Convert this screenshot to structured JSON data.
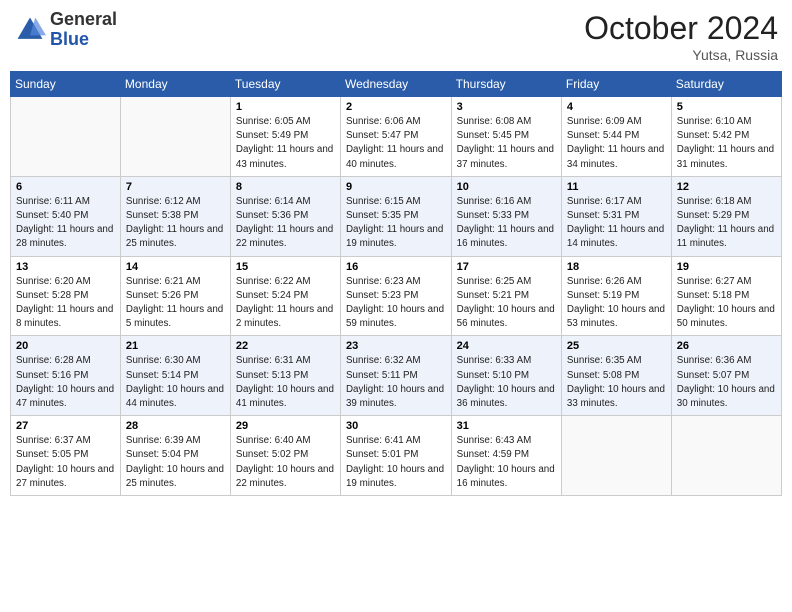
{
  "logo": {
    "general": "General",
    "blue": "Blue"
  },
  "title": "October 2024",
  "location": "Yutsa, Russia",
  "days_header": [
    "Sunday",
    "Monday",
    "Tuesday",
    "Wednesday",
    "Thursday",
    "Friday",
    "Saturday"
  ],
  "weeks": [
    [
      {
        "num": "",
        "detail": ""
      },
      {
        "num": "",
        "detail": ""
      },
      {
        "num": "1",
        "detail": "Sunrise: 6:05 AM\nSunset: 5:49 PM\nDaylight: 11 hours\nand 43 minutes."
      },
      {
        "num": "2",
        "detail": "Sunrise: 6:06 AM\nSunset: 5:47 PM\nDaylight: 11 hours\nand 40 minutes."
      },
      {
        "num": "3",
        "detail": "Sunrise: 6:08 AM\nSunset: 5:45 PM\nDaylight: 11 hours\nand 37 minutes."
      },
      {
        "num": "4",
        "detail": "Sunrise: 6:09 AM\nSunset: 5:44 PM\nDaylight: 11 hours\nand 34 minutes."
      },
      {
        "num": "5",
        "detail": "Sunrise: 6:10 AM\nSunset: 5:42 PM\nDaylight: 11 hours\nand 31 minutes."
      }
    ],
    [
      {
        "num": "6",
        "detail": "Sunrise: 6:11 AM\nSunset: 5:40 PM\nDaylight: 11 hours\nand 28 minutes."
      },
      {
        "num": "7",
        "detail": "Sunrise: 6:12 AM\nSunset: 5:38 PM\nDaylight: 11 hours\nand 25 minutes."
      },
      {
        "num": "8",
        "detail": "Sunrise: 6:14 AM\nSunset: 5:36 PM\nDaylight: 11 hours\nand 22 minutes."
      },
      {
        "num": "9",
        "detail": "Sunrise: 6:15 AM\nSunset: 5:35 PM\nDaylight: 11 hours\nand 19 minutes."
      },
      {
        "num": "10",
        "detail": "Sunrise: 6:16 AM\nSunset: 5:33 PM\nDaylight: 11 hours\nand 16 minutes."
      },
      {
        "num": "11",
        "detail": "Sunrise: 6:17 AM\nSunset: 5:31 PM\nDaylight: 11 hours\nand 14 minutes."
      },
      {
        "num": "12",
        "detail": "Sunrise: 6:18 AM\nSunset: 5:29 PM\nDaylight: 11 hours\nand 11 minutes."
      }
    ],
    [
      {
        "num": "13",
        "detail": "Sunrise: 6:20 AM\nSunset: 5:28 PM\nDaylight: 11 hours\nand 8 minutes."
      },
      {
        "num": "14",
        "detail": "Sunrise: 6:21 AM\nSunset: 5:26 PM\nDaylight: 11 hours\nand 5 minutes."
      },
      {
        "num": "15",
        "detail": "Sunrise: 6:22 AM\nSunset: 5:24 PM\nDaylight: 11 hours\nand 2 minutes."
      },
      {
        "num": "16",
        "detail": "Sunrise: 6:23 AM\nSunset: 5:23 PM\nDaylight: 10 hours\nand 59 minutes."
      },
      {
        "num": "17",
        "detail": "Sunrise: 6:25 AM\nSunset: 5:21 PM\nDaylight: 10 hours\nand 56 minutes."
      },
      {
        "num": "18",
        "detail": "Sunrise: 6:26 AM\nSunset: 5:19 PM\nDaylight: 10 hours\nand 53 minutes."
      },
      {
        "num": "19",
        "detail": "Sunrise: 6:27 AM\nSunset: 5:18 PM\nDaylight: 10 hours\nand 50 minutes."
      }
    ],
    [
      {
        "num": "20",
        "detail": "Sunrise: 6:28 AM\nSunset: 5:16 PM\nDaylight: 10 hours\nand 47 minutes."
      },
      {
        "num": "21",
        "detail": "Sunrise: 6:30 AM\nSunset: 5:14 PM\nDaylight: 10 hours\nand 44 minutes."
      },
      {
        "num": "22",
        "detail": "Sunrise: 6:31 AM\nSunset: 5:13 PM\nDaylight: 10 hours\nand 41 minutes."
      },
      {
        "num": "23",
        "detail": "Sunrise: 6:32 AM\nSunset: 5:11 PM\nDaylight: 10 hours\nand 39 minutes."
      },
      {
        "num": "24",
        "detail": "Sunrise: 6:33 AM\nSunset: 5:10 PM\nDaylight: 10 hours\nand 36 minutes."
      },
      {
        "num": "25",
        "detail": "Sunrise: 6:35 AM\nSunset: 5:08 PM\nDaylight: 10 hours\nand 33 minutes."
      },
      {
        "num": "26",
        "detail": "Sunrise: 6:36 AM\nSunset: 5:07 PM\nDaylight: 10 hours\nand 30 minutes."
      }
    ],
    [
      {
        "num": "27",
        "detail": "Sunrise: 6:37 AM\nSunset: 5:05 PM\nDaylight: 10 hours\nand 27 minutes."
      },
      {
        "num": "28",
        "detail": "Sunrise: 6:39 AM\nSunset: 5:04 PM\nDaylight: 10 hours\nand 25 minutes."
      },
      {
        "num": "29",
        "detail": "Sunrise: 6:40 AM\nSunset: 5:02 PM\nDaylight: 10 hours\nand 22 minutes."
      },
      {
        "num": "30",
        "detail": "Sunrise: 6:41 AM\nSunset: 5:01 PM\nDaylight: 10 hours\nand 19 minutes."
      },
      {
        "num": "31",
        "detail": "Sunrise: 6:43 AM\nSunset: 4:59 PM\nDaylight: 10 hours\nand 16 minutes."
      },
      {
        "num": "",
        "detail": ""
      },
      {
        "num": "",
        "detail": ""
      }
    ]
  ]
}
